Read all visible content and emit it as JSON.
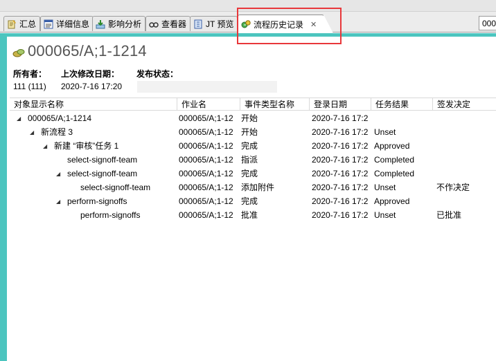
{
  "tabs": [
    {
      "label": "汇总",
      "icon": "summary-icon"
    },
    {
      "label": "详细信息",
      "icon": "details-icon"
    },
    {
      "label": "影响分析",
      "icon": "impact-analysis-icon"
    },
    {
      "label": "查看器",
      "icon": "viewer-icon"
    },
    {
      "label": "JT 预览",
      "icon": "jt-preview-icon"
    },
    {
      "label": "流程历史记录",
      "icon": "process-history-icon",
      "active": true
    }
  ],
  "search": {
    "value": "000"
  },
  "object": {
    "title": "000065/A;1-1214"
  },
  "properties": {
    "owner_label": "所有者：",
    "modified_label": "上次修改日期：",
    "status_label": "发布状态：",
    "owner_value": "111 (111)",
    "modified_value": "2020-7-16 17:20",
    "status_value": ""
  },
  "table": {
    "columns": [
      "对象显示名称",
      "作业名",
      "事件类型名称",
      "登录日期",
      "任务结果",
      "签发决定"
    ],
    "rows": [
      {
        "indent": 0,
        "expanded": true,
        "name": "000065/A;1-1214",
        "job": "000065/A;1-12",
        "event": "开始",
        "date": "2020-7-16 17:2",
        "result": "",
        "decision": ""
      },
      {
        "indent": 1,
        "expanded": true,
        "name": "新流程 3",
        "job": "000065/A;1-12",
        "event": "开始",
        "date": "2020-7-16 17:2",
        "result": "Unset",
        "decision": ""
      },
      {
        "indent": 2,
        "expanded": true,
        "name": "新建 “审核”任务 1",
        "job": "000065/A;1-12",
        "event": "完成",
        "date": "2020-7-16 17:2",
        "result": "Approved",
        "decision": ""
      },
      {
        "indent": 3,
        "expanded": false,
        "name": "select-signoff-team",
        "job": "000065/A;1-12",
        "event": "指派",
        "date": "2020-7-16 17:2",
        "result": "Completed",
        "decision": ""
      },
      {
        "indent": 3,
        "expanded": true,
        "name": "select-signoff-team",
        "job": "000065/A;1-12",
        "event": "完成",
        "date": "2020-7-16 17:2",
        "result": "Completed",
        "decision": ""
      },
      {
        "indent": 4,
        "expanded": false,
        "name": "select-signoff-team",
        "job": "000065/A;1-12",
        "event": "添加附件",
        "date": "2020-7-16 17:2",
        "result": "Unset",
        "decision": "不作决定"
      },
      {
        "indent": 3,
        "expanded": true,
        "name": "perform-signoffs",
        "job": "000065/A;1-12",
        "event": "完成",
        "date": "2020-7-16 17:2",
        "result": "Approved",
        "decision": ""
      },
      {
        "indent": 4,
        "expanded": false,
        "name": "perform-signoffs",
        "job": "000065/A;1-12",
        "event": "批准",
        "date": "2020-7-16 17:2",
        "result": "Unset",
        "decision": "已批准"
      }
    ]
  },
  "colors": {
    "highlight": "#e8373a",
    "frame": "#4cc5bf",
    "title": "#555555"
  }
}
